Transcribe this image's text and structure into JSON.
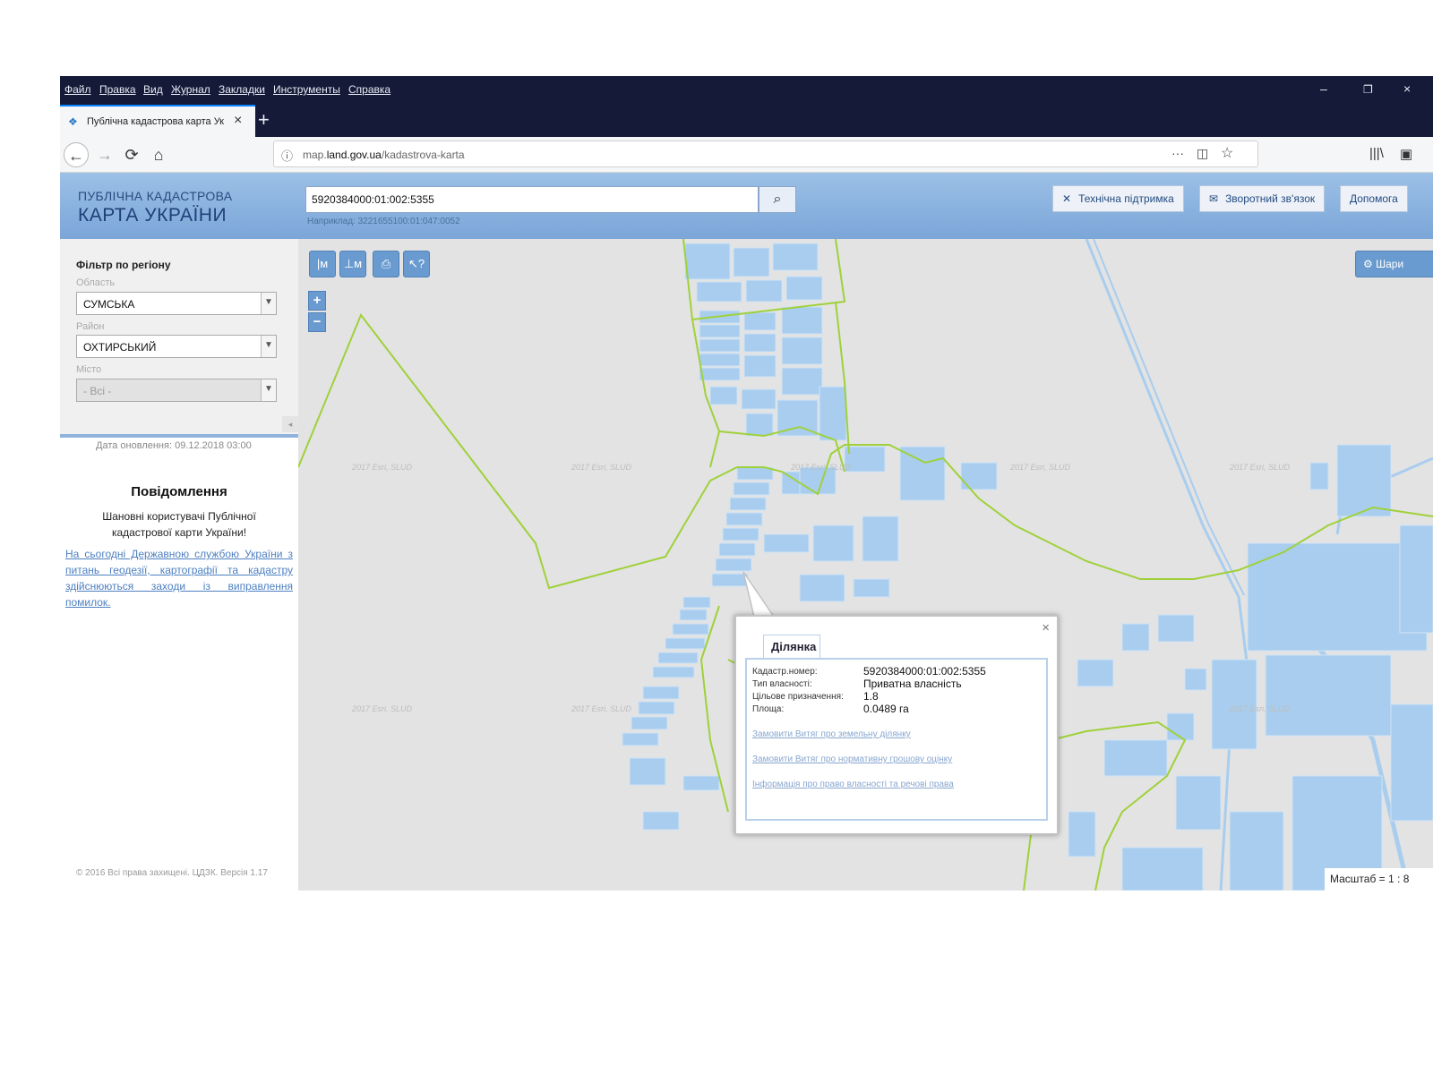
{
  "browser": {
    "menu": [
      "Файл",
      "Правка",
      "Вид",
      "Журнал",
      "Закладки",
      "Инструменты",
      "Справка"
    ],
    "window_controls": [
      "–",
      "❐",
      "×"
    ],
    "tab_title": "Публічна кадастрова карта Ук",
    "tab_close": "×",
    "new_tab": "+",
    "url_prefix": "map.",
    "url_domain": "land.gov.ua",
    "url_path": "/kadastrova-karta",
    "url_icons": [
      "···",
      "◫",
      "☆"
    ],
    "toolbar_icons": [
      "|||\\",
      "▣"
    ],
    "nav": {
      "back": "←",
      "forward": "→",
      "reload": "⟳",
      "home": "⌂"
    }
  },
  "header": {
    "logo_line1": "ПУБЛІЧНА КАДАСТРОВА",
    "logo_line2": "КАРТА УКРАЇНИ",
    "search_value": "5920384000:01:002:5355",
    "search_example": "Наприклад: 3221655100:01:047:0052",
    "buttons": [
      {
        "icon": "✕",
        "label": "Технічна підтримка"
      },
      {
        "icon": "✉",
        "label": "Зворотний зв'язок"
      },
      {
        "icon": "",
        "label": "Допомога"
      }
    ]
  },
  "sidebar": {
    "filter_title": "Фільтр по регіону",
    "oblast_label": "Область",
    "oblast_value": "СУМСЬКА",
    "raion_label": "Район",
    "raion_value": "ОХТИРСЬКИЙ",
    "misto_label": "Місто",
    "misto_value": "- Всі -",
    "collapse": "◂",
    "updated": "Дата оновлення: 09.12.2018 03:00",
    "news_title": "Повідомлення",
    "news_text": "Шановні користувачі Публічної кадастрової карти України!",
    "news_link": "На сьогодні Державною службою України з питань геодезії, картографії та кадастру здійснюються заходи із виправлення помилок.",
    "copyright": "© 2016 Всі права захищені. ЦДЗК. Версія 1.17"
  },
  "map": {
    "tools": [
      "|м",
      "⊥м",
      "⎙",
      "↖?"
    ],
    "zoom_in": "+",
    "zoom_out": "−",
    "layers_button": "⚙ Шари",
    "watermark": "2017 Esri, SLUD",
    "scale": "Масштаб = 1 : 8",
    "colors": {
      "parcels": "#a9cdee",
      "boundary": "#9fd13a",
      "road": "#a9cdee",
      "background": "#e3e3e3"
    }
  },
  "popup": {
    "close": "×",
    "tab": "Ділянка",
    "rows": [
      {
        "key": "Кадастр.номер:",
        "value": "5920384000:01:002:5355"
      },
      {
        "key": "Тип власності:",
        "value": "Приватна власність"
      },
      {
        "key": "Цільове призначення:",
        "value": "1.8"
      },
      {
        "key": "Площа:",
        "value": "0.0489 га"
      }
    ],
    "links": [
      "Замовити Витяг про земельну ділянку",
      "Замовити Витяг про нормативну грошову оцінку",
      "Інформація про право власності та речові права"
    ]
  }
}
